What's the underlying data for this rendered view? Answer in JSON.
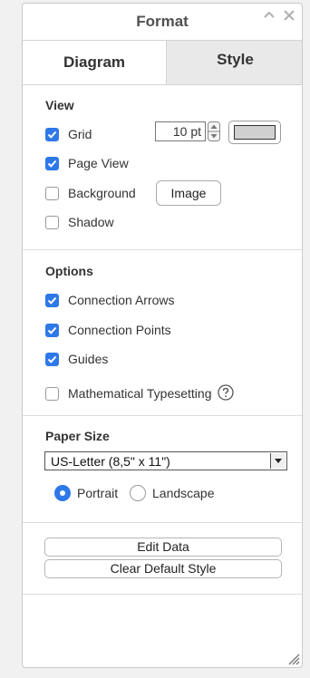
{
  "header": {
    "title": "Format"
  },
  "tabs": [
    {
      "label": "Diagram"
    },
    {
      "label": "Style"
    }
  ],
  "view": {
    "title": "View",
    "grid": {
      "label": "Grid",
      "checked": true,
      "size": "10 pt",
      "color": "#d0d0d0"
    },
    "page_view": {
      "label": "Page View",
      "checked": true
    },
    "background": {
      "label": "Background",
      "checked": false,
      "button": "Image"
    },
    "shadow": {
      "label": "Shadow",
      "checked": false
    }
  },
  "options": {
    "title": "Options",
    "connection_arrows": {
      "label": "Connection Arrows",
      "checked": true
    },
    "connection_points": {
      "label": "Connection Points",
      "checked": true
    },
    "guides": {
      "label": "Guides",
      "checked": true
    },
    "math": {
      "label": "Mathematical Typesetting",
      "checked": false
    }
  },
  "paper": {
    "title": "Paper Size",
    "selected": "US-Letter (8,5\" x 11\")",
    "portrait": {
      "label": "Portrait",
      "selected": true
    },
    "landscape": {
      "label": "Landscape",
      "selected": false
    }
  },
  "actions": {
    "edit_data": "Edit Data",
    "clear_default_style": "Clear Default Style"
  },
  "colors": {
    "accent": "#2f78e8",
    "tab_inactive": "#e9e9e9"
  }
}
